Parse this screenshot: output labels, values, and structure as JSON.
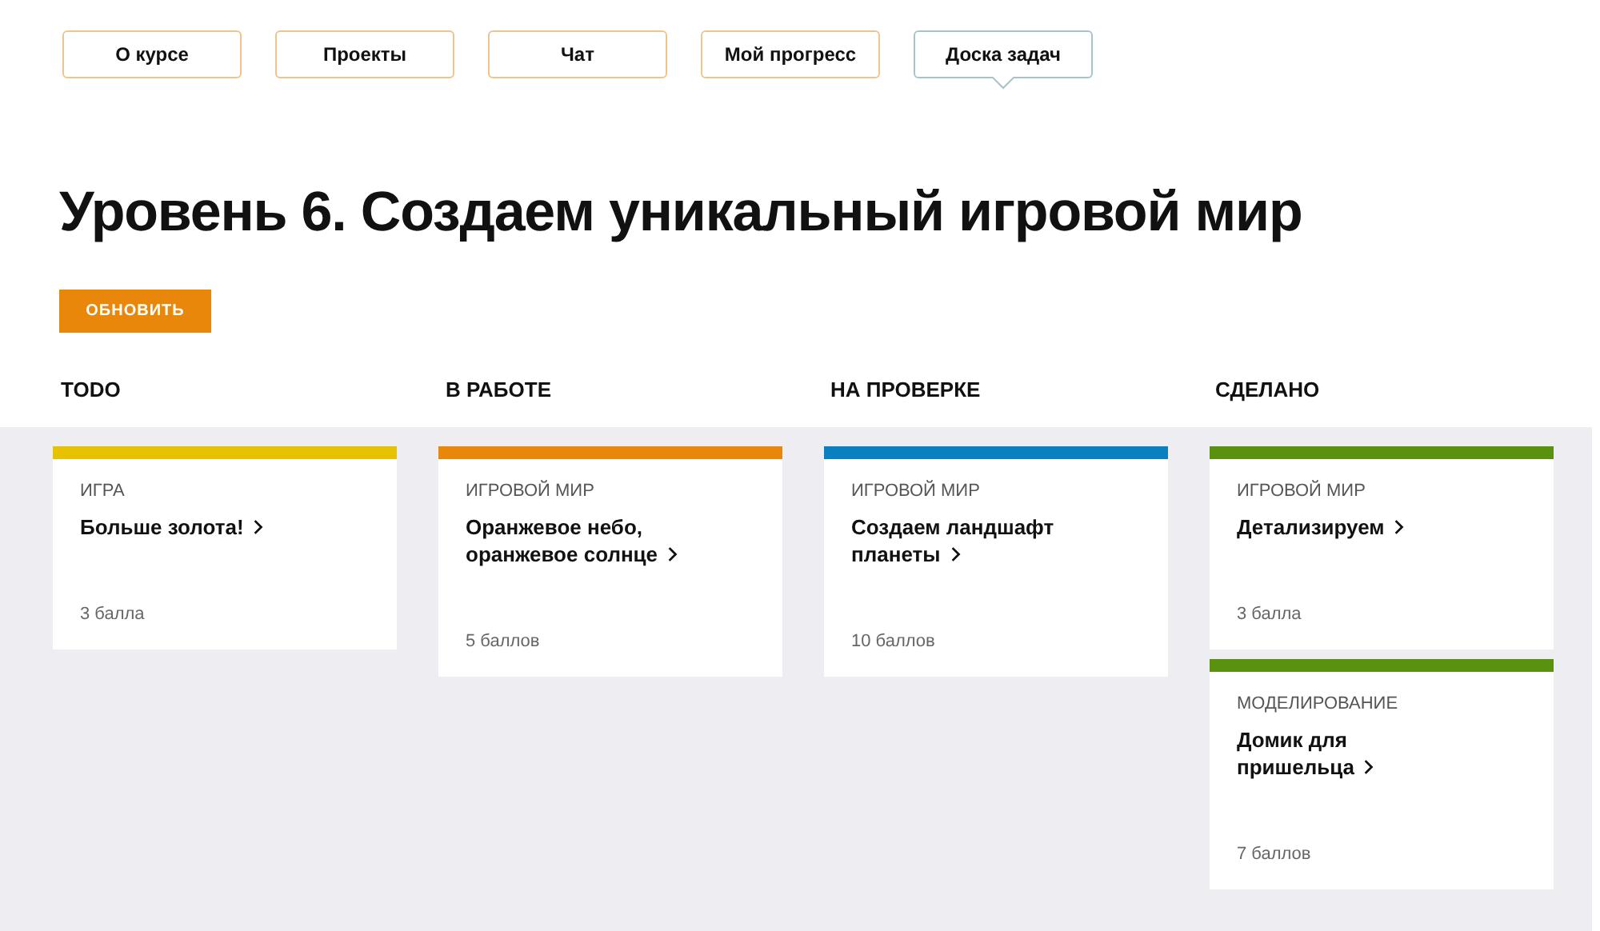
{
  "tabs": [
    {
      "label": "О курсе",
      "selected": false
    },
    {
      "label": "Проекты",
      "selected": false
    },
    {
      "label": "Чат",
      "selected": false
    },
    {
      "label": "Мой прогресс",
      "selected": false
    },
    {
      "label": "Доска задач",
      "selected": true
    }
  ],
  "heading": "Уровень 6. Создаем уникальный игровой мир",
  "refresh_button": "ОБНОВИТЬ",
  "columns": [
    {
      "title": "TODO",
      "color": "#e6c200",
      "cards": [
        {
          "category": "ИГРА",
          "title": "Больше золота!",
          "points": "3 балла"
        }
      ]
    },
    {
      "title": "В РАБОТЕ",
      "color": "#e8870a",
      "cards": [
        {
          "category": "ИГРОВОЙ МИР",
          "title": "Оранжевое небо, оранжевое солнце",
          "points": "5 баллов"
        }
      ]
    },
    {
      "title": "НА ПРОВЕРКЕ",
      "color": "#0a80c0",
      "cards": [
        {
          "category": "ИГРОВОЙ МИР",
          "title": "Создаем ландшафт планеты",
          "points": "10 баллов"
        }
      ]
    },
    {
      "title": "СДЕЛАНО",
      "color": "#5a9210",
      "cards": [
        {
          "category": "ИГРОВОЙ МИР",
          "title": "Детализируем",
          "points": "3 балла"
        },
        {
          "category": "МОДЕЛИРОВАНИЕ",
          "title": "Домик для пришельца",
          "points": "7 баллов"
        }
      ]
    }
  ]
}
